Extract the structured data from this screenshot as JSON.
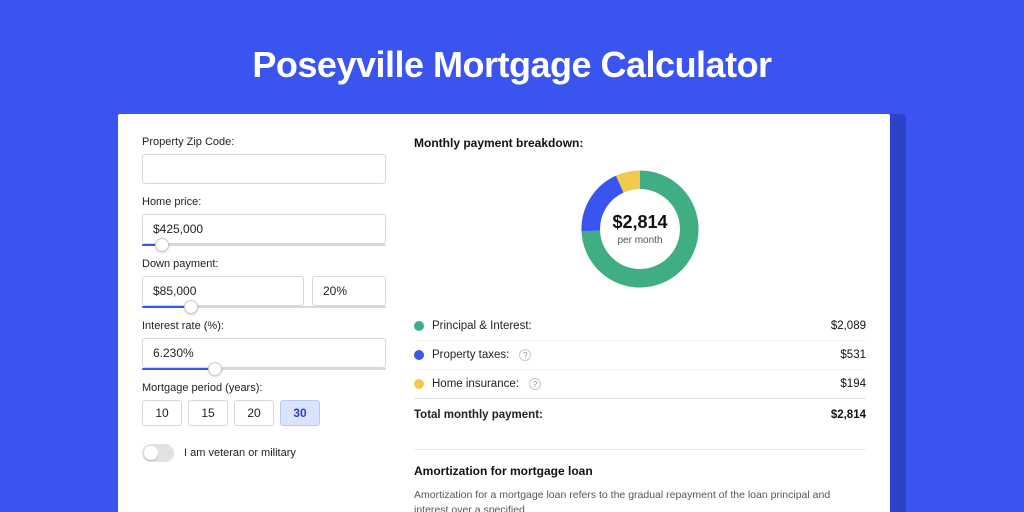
{
  "hero": {
    "title": "Poseyville Mortgage Calculator"
  },
  "form": {
    "zip": {
      "label": "Property Zip Code:",
      "value": ""
    },
    "price": {
      "label": "Home price:",
      "value": "$425,000",
      "slider_pct": 8
    },
    "down": {
      "label": "Down payment:",
      "value": "$85,000",
      "pct": "20%",
      "slider_pct": 20
    },
    "rate": {
      "label": "Interest rate (%):",
      "value": "6.230%",
      "slider_pct": 30
    },
    "period": {
      "label": "Mortgage period (years):",
      "options": [
        "10",
        "15",
        "20",
        "30"
      ],
      "selected": "30"
    },
    "veteran_label": "I am veteran or military",
    "veteran_on": false
  },
  "breakdown": {
    "title": "Monthly payment breakdown:",
    "center_amount": "$2,814",
    "center_sub": "per month",
    "items": [
      {
        "label": "Principal & Interest:",
        "value": "$2,089",
        "color": "green",
        "help": false
      },
      {
        "label": "Property taxes:",
        "value": "$531",
        "color": "blue",
        "help": true
      },
      {
        "label": "Home insurance:",
        "value": "$194",
        "color": "yellow",
        "help": true
      }
    ],
    "total_label": "Total monthly payment:",
    "total_value": "$2,814"
  },
  "amort": {
    "title": "Amortization for mortgage loan",
    "text": "Amortization for a mortgage loan refers to the gradual repayment of the loan principal and interest over a specified"
  },
  "chart_data": {
    "type": "pie",
    "title": "Monthly payment breakdown",
    "series": [
      {
        "name": "Principal & Interest",
        "value": 2089,
        "color": "#3fae82"
      },
      {
        "name": "Property taxes",
        "value": 531,
        "color": "#3a55ef"
      },
      {
        "name": "Home insurance",
        "value": 194,
        "color": "#f2c94c"
      }
    ],
    "total": 2814,
    "center_label": "$2,814 per month"
  }
}
